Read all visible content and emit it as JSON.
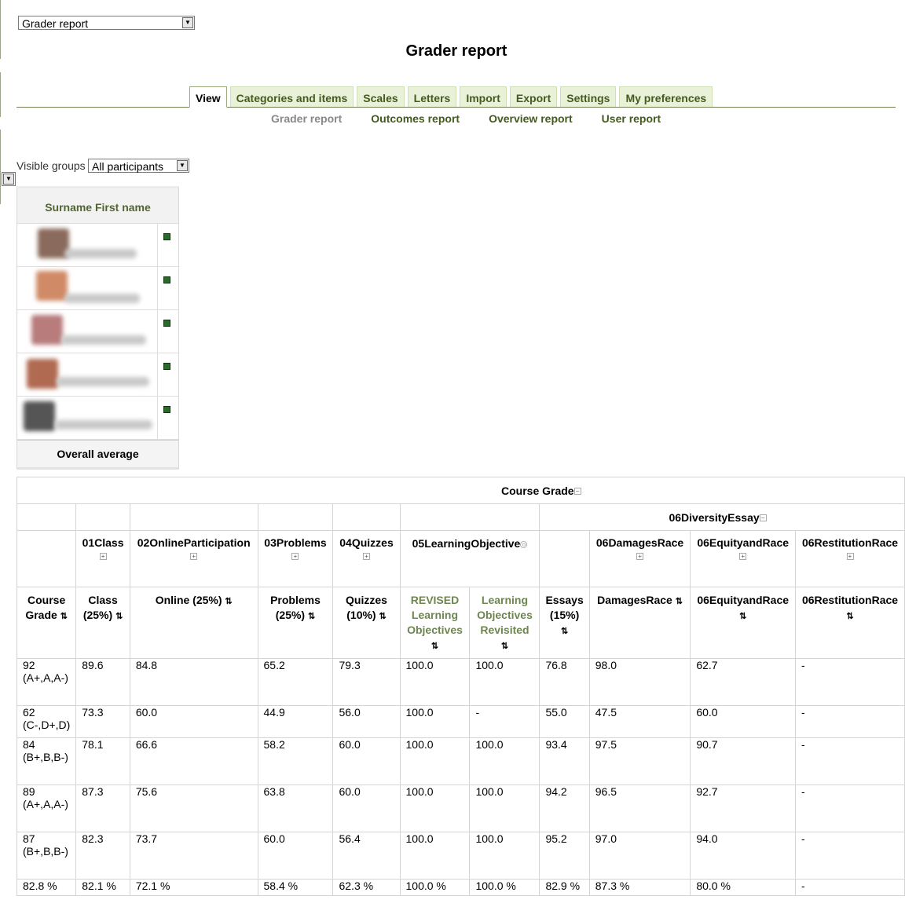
{
  "top_select": {
    "value": "Grader report"
  },
  "page_title": "Grader report",
  "tabs": [
    "View",
    "Categories and items",
    "Scales",
    "Letters",
    "Import",
    "Export",
    "Settings",
    "My preferences"
  ],
  "subtabs": [
    "Grader report",
    "Outcomes report",
    "Overview report",
    "User report"
  ],
  "visible_groups": {
    "label": "Visible groups",
    "value": "All participants"
  },
  "name_column": {
    "header": "Surname First name",
    "footer": "Overall average"
  },
  "table": {
    "course_grade_header": "Course Grade",
    "category_header": "06DiversityEssay",
    "item_categories": [
      "01Class",
      "02OnlineParticipation",
      "03Problems",
      "04Quizzes",
      "05LearningObjective",
      "06DamagesRace",
      "06EquityandRace",
      "06RestitutionRace"
    ],
    "columns": [
      "Course Grade",
      "Class (25%)",
      "Online (25%)",
      "Problems (25%)",
      "Quizzes (10%)",
      "REVISED Learning Objectives",
      "Learning Objectives Revisited",
      "Essays (15%)",
      "DamagesRace",
      "06EquityandRace",
      "06RestitutionRace"
    ],
    "rows": [
      [
        "92 (A+,A,A-)",
        "89.6",
        "84.8",
        "65.2",
        "79.3",
        "100.0",
        "100.0",
        "76.8",
        "98.0",
        "62.7",
        "-"
      ],
      [
        "62 (C-,D+,D)",
        "73.3",
        "60.0",
        "44.9",
        "56.0",
        "100.0",
        "-",
        "55.0",
        "47.5",
        "60.0",
        "-"
      ],
      [
        "84 (B+,B,B-)",
        "78.1",
        "66.6",
        "58.2",
        "60.0",
        "100.0",
        "100.0",
        "93.4",
        "97.5",
        "90.7",
        "-"
      ],
      [
        "89 (A+,A,A-)",
        "87.3",
        "75.6",
        "63.8",
        "60.0",
        "100.0",
        "100.0",
        "94.2",
        "96.5",
        "92.7",
        "-"
      ],
      [
        "87 (B+,B,B-)",
        "82.3",
        "73.7",
        "60.0",
        "56.4",
        "100.0",
        "100.0",
        "95.2",
        "97.0",
        "94.0",
        "-"
      ]
    ],
    "averages": [
      "82.8 %",
      "82.1 %",
      "72.1 %",
      "58.4 %",
      "62.3 %",
      "100.0 %",
      "100.0 %",
      "82.9 %",
      "87.3 %",
      "80.0 %",
      "-"
    ]
  }
}
